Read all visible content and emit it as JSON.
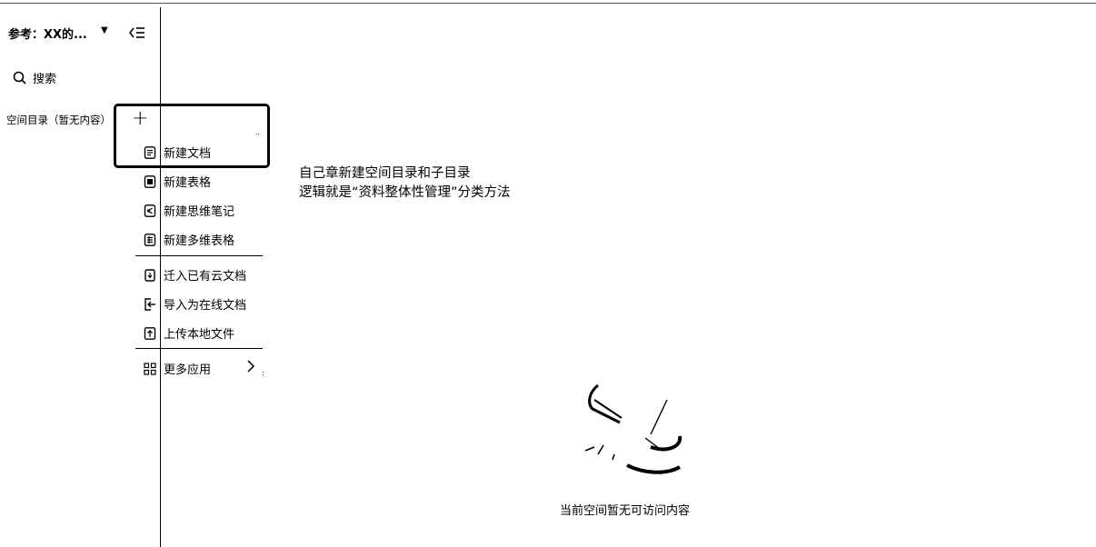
{
  "sidebar": {
    "space_title": "参考：XX的...",
    "search_label": "搜索",
    "directory_label": "空间目录（暂无内容）"
  },
  "menu": {
    "items": [
      {
        "label": "新建文档",
        "icon": "doc-icon"
      },
      {
        "label": "新建表格",
        "icon": "sheet-icon"
      },
      {
        "label": "新建思维笔记",
        "icon": "mindnote-icon"
      },
      {
        "label": "新建多维表格",
        "icon": "bitable-icon"
      },
      {
        "label": "迁入已有云文档",
        "icon": "move-in-icon"
      },
      {
        "label": "导入为在线文档",
        "icon": "import-icon"
      },
      {
        "label": "上传本地文件",
        "icon": "upload-icon"
      },
      {
        "label": "更多应用",
        "icon": "apps-icon"
      }
    ]
  },
  "annotation": {
    "line1": "自己章新建空间目录和子目录",
    "line2": "逻辑就是“资料整体性管理”分类方法"
  },
  "empty_state": {
    "text": "当前空间暂无可访问内容"
  }
}
